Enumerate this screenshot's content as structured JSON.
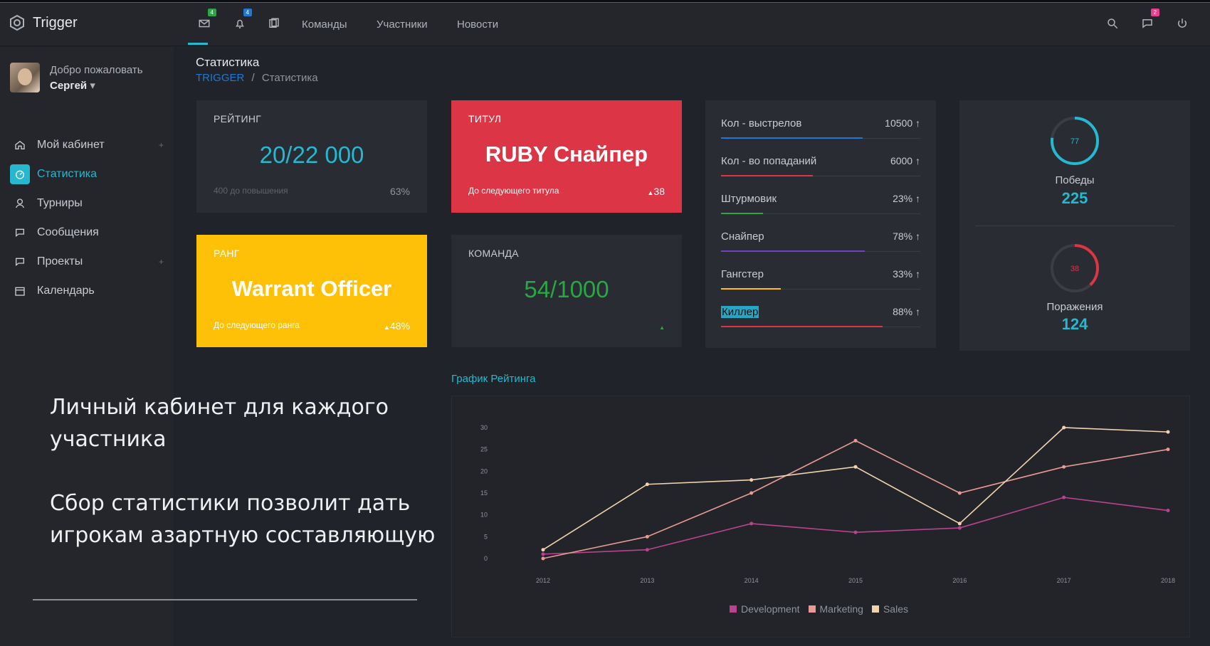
{
  "app": {
    "name": "Trigger"
  },
  "topbar": {
    "mail_badge": "4",
    "bell_badge": "4",
    "nav": [
      "Команды",
      "Участники",
      "Новости"
    ],
    "chat_badge": "2"
  },
  "user": {
    "greeting": "Добро пожаловать",
    "name": "Сергей"
  },
  "sidebar": {
    "items": [
      {
        "label": "Мой кабинет",
        "icon": "home-icon"
      },
      {
        "label": "Статистика",
        "icon": "dashboard-icon"
      },
      {
        "label": "Турниры",
        "icon": "trophy-icon"
      },
      {
        "label": "Сообщения",
        "icon": "chat-icon"
      },
      {
        "label": "Проекты",
        "icon": "chat-icon"
      },
      {
        "label": "Календарь",
        "icon": "calendar-icon"
      }
    ]
  },
  "page": {
    "title": "Статистика",
    "breadcrumb_root": "TRIGGER",
    "breadcrumb_current": "Статистика"
  },
  "cards": {
    "rating": {
      "title": "РЕЙТИНГ",
      "value": "20/22 000",
      "footer": "400 до повышения",
      "percent": "63%"
    },
    "title_card": {
      "title": "ТИТУЛ",
      "value": "RUBY Снайпер",
      "footer": "До следующего титула",
      "change": "38"
    },
    "rank": {
      "title": "РАНГ",
      "value": "Warrant Officer",
      "footer": "До следующего ранга",
      "change": "48%"
    },
    "team": {
      "title": "КОМАНДА",
      "value": "54/1000"
    }
  },
  "stats": [
    {
      "label": "Кол - выстрелов",
      "value": "10500",
      "fill": 0.71,
      "color": "#1f78d1"
    },
    {
      "label": "Кол - во попаданий",
      "value": "6000",
      "fill": 0.46,
      "color": "#dc3545"
    },
    {
      "label": "Штурмовик",
      "value": "23%",
      "fill": 0.21,
      "color": "#28a745"
    },
    {
      "label": "Снайпер",
      "value": "78%",
      "fill": 0.72,
      "color": "#6f42c1"
    },
    {
      "label": "Гангстер",
      "value": "33%",
      "fill": 0.3,
      "color": "#ffc107"
    },
    {
      "label": "Киллер",
      "value": "88%",
      "fill": 0.81,
      "color": "#dc3545"
    }
  ],
  "wins": {
    "ring_value": "77",
    "label": "Победы",
    "count": "225",
    "fraction": 0.77,
    "color": "#25b8cf"
  },
  "losses": {
    "ring_value": "38",
    "label": "Поражения",
    "count": "124",
    "fraction": 0.38,
    "color": "#dc3545"
  },
  "chart_title": "График Рейтинга",
  "chart_data": {
    "type": "line",
    "x": [
      "2012",
      "2013",
      "2014",
      "2015",
      "2016",
      "2017",
      "2018"
    ],
    "ylim": [
      0,
      30
    ],
    "yticks": [
      0,
      5,
      10,
      15,
      20,
      25,
      30
    ],
    "legend_position": "bottom",
    "series": [
      {
        "name": "Development",
        "color": "#b8448f",
        "values": [
          1,
          2,
          8,
          6,
          7,
          14,
          11
        ]
      },
      {
        "name": "Marketing",
        "color": "#e89a94",
        "values": [
          0,
          5,
          15,
          27,
          15,
          21,
          25
        ]
      },
      {
        "name": "Sales",
        "color": "#f2d3b0",
        "values": [
          2,
          17,
          18,
          21,
          8,
          30,
          29
        ]
      }
    ]
  },
  "overlay_text": {
    "line1": "Личный кабинет для каждого участника",
    "line2": "Сбор статистики позволит дать игрокам азартную составляющую"
  }
}
